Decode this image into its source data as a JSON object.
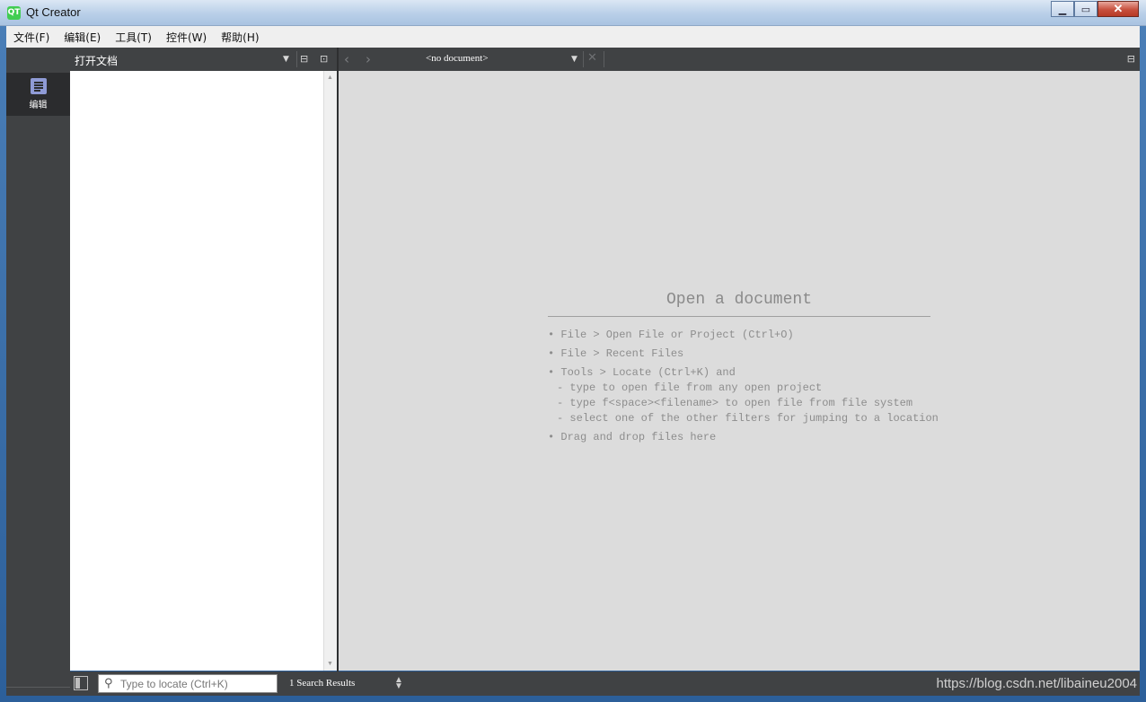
{
  "window": {
    "title": "Qt Creator",
    "icon_text": "QT"
  },
  "menubar": {
    "items": [
      "文件(F)",
      "编辑(E)",
      "工具(T)",
      "控件(W)",
      "帮助(H)"
    ]
  },
  "modebar": {
    "edit_label": "编辑"
  },
  "left_pane": {
    "title": "打开文档"
  },
  "editor": {
    "document_label": "<no document>",
    "welcome_title": "Open a document",
    "hints": [
      "• File > Open File or Project (Ctrl+O)",
      "• File > Recent Files",
      "• Tools > Locate (Ctrl+K) and"
    ],
    "sub_hints": [
      "- type to open file from any open project",
      "- type f<space><filename> to open file from file system",
      "- select one of the other filters for jumping to a location"
    ],
    "drag_hint": "• Drag and drop files here"
  },
  "statusbar": {
    "locator_placeholder": "Type to locate (Ctrl+K)",
    "output_tab": "1  Search Results",
    "watermark": "https://blog.csdn.net/libaineu2004"
  },
  "colors": {
    "dark_panel": "#404244",
    "editor_bg": "#dcdcdc",
    "mode_icon": "#8f9bd6"
  }
}
